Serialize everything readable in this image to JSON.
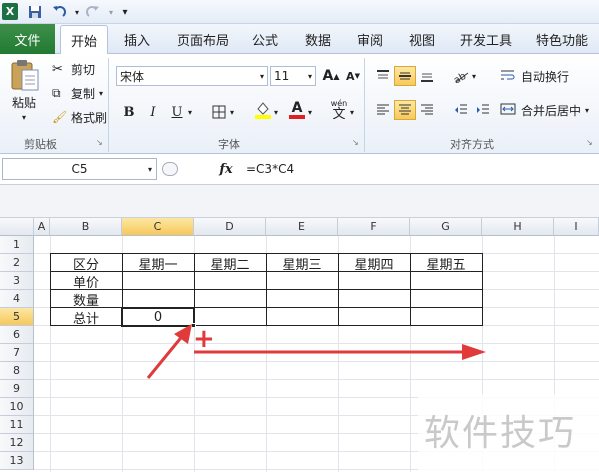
{
  "quick_access": {
    "app_icon": "X",
    "save_icon": "floppy-icon",
    "undo_icon": "undo-icon",
    "redo_icon": "redo-icon"
  },
  "tabs": {
    "file": "文件",
    "home": "开始",
    "items": [
      "插入",
      "页面布局",
      "公式",
      "数据",
      "审阅",
      "视图",
      "开发工具",
      "特色功能"
    ]
  },
  "clipboard": {
    "paste": "粘贴",
    "cut": "剪切",
    "copy": "复制",
    "format_painter": "格式刷",
    "group_label": "剪贴板"
  },
  "font": {
    "name": "宋体",
    "size": "11",
    "bold": "B",
    "italic": "I",
    "underline": "U",
    "group_label": "字体",
    "grow": "A",
    "shrink": "A",
    "phonetic": "wén",
    "color_a": "A"
  },
  "alignment": {
    "wrap": "自动换行",
    "merge": "合并后居中",
    "group_label": "对齐方式"
  },
  "formula_bar": {
    "name_box": "C5",
    "fx": "fx",
    "formula": "=C3*C4"
  },
  "columns": [
    "A",
    "B",
    "C",
    "D",
    "E",
    "F",
    "G",
    "H",
    "I"
  ],
  "rows": [
    "1",
    "2",
    "3",
    "4",
    "5",
    "6",
    "7",
    "8",
    "9",
    "10",
    "11",
    "12",
    "13"
  ],
  "table": {
    "header": [
      "区分",
      "星期一",
      "星期二",
      "星期三",
      "星期四",
      "星期五"
    ],
    "row_labels": [
      "单价",
      "数量",
      "总计"
    ],
    "c5_value": "0"
  },
  "annotation": {
    "plus": "+",
    "watermark": "软件技巧",
    "arrow_color": "#e03a3a"
  },
  "colors": {
    "accent_green": "#227a32",
    "selection": "#f7c95a"
  }
}
